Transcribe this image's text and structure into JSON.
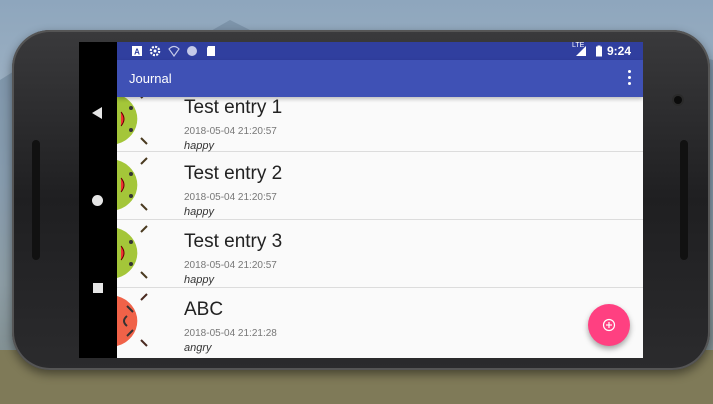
{
  "status_bar": {
    "time": "9:24",
    "network": "LTE",
    "icons": [
      "notification-a-icon",
      "settings-icon",
      "wifi-icon",
      "sync-icon",
      "sd-card-icon",
      "signal-icon",
      "battery-icon"
    ]
  },
  "app_bar": {
    "title": "Journal",
    "menu_icon": "overflow-menu-icon",
    "color": "#3f51b5",
    "status_color": "#303f9f"
  },
  "navigation": {
    "back_icon": "back-icon",
    "home_icon": "home-icon",
    "recents_icon": "recents-icon"
  },
  "entries": [
    {
      "title": "Test entry 1",
      "date": "2018-05-04 21:20:57",
      "mood": "happy",
      "avatar": "happy-android-icon"
    },
    {
      "title": "Test entry 2",
      "date": "2018-05-04 21:20:57",
      "mood": "happy",
      "avatar": "happy-android-icon"
    },
    {
      "title": "Test entry 3",
      "date": "2018-05-04 21:20:57",
      "mood": "happy",
      "avatar": "happy-android-icon"
    },
    {
      "title": "ABC",
      "date": "2018-05-04 21:21:28",
      "mood": "angry",
      "avatar": "angry-android-icon"
    }
  ],
  "fab": {
    "icon": "add-circle-icon",
    "color": "#ff4081"
  }
}
